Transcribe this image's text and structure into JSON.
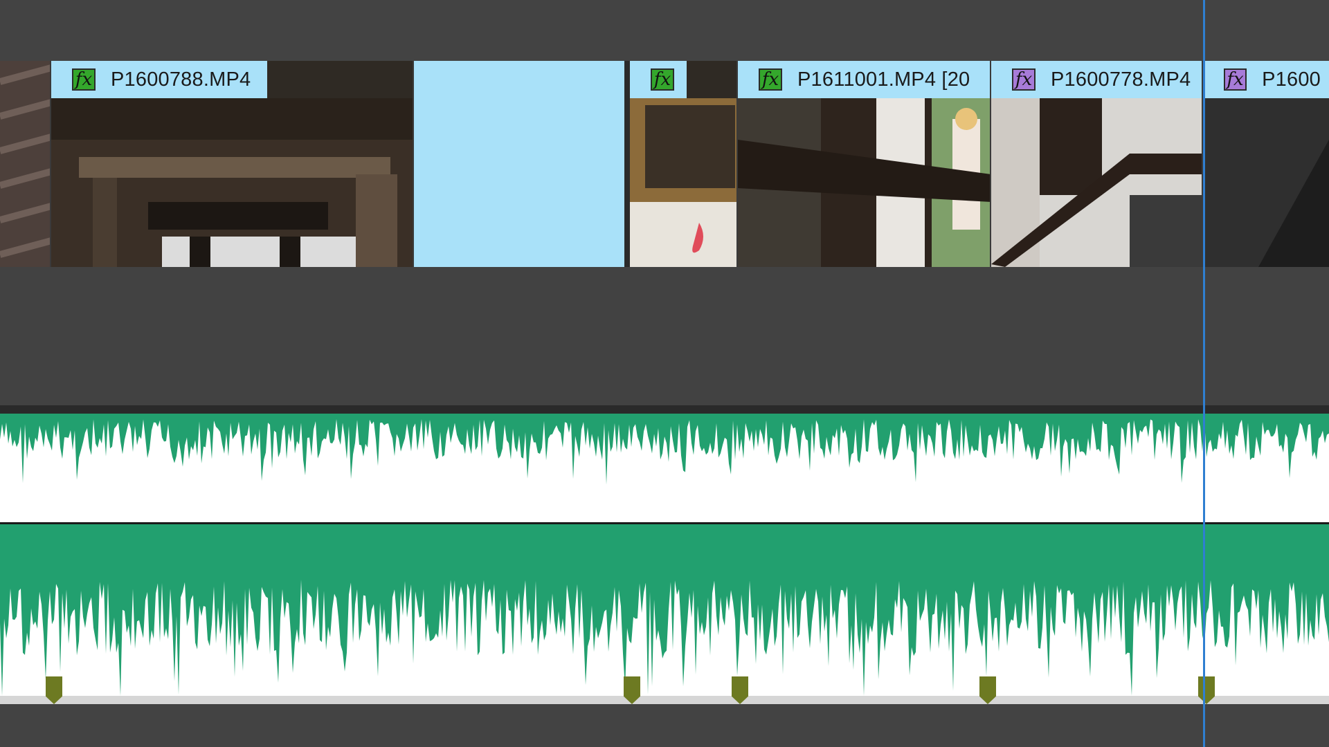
{
  "timeline": {
    "clips": [
      {
        "name": "P1600788.MP4",
        "fx": "green"
      },
      {
        "name": "",
        "fx": "green"
      },
      {
        "name": "P1611001.MP4 [20",
        "fx": "green"
      },
      {
        "name": "P1600778.MP4",
        "fx": "purple"
      },
      {
        "name": "P1600",
        "fx": "purple"
      }
    ],
    "fx_label": "fx",
    "colors": {
      "clip_header": "#a9e1f9",
      "fx_green": "#34a72c",
      "fx_purple": "#a77bd8",
      "waveform": "#22a06f",
      "marker": "#6d7a22",
      "playhead": "#2f7fd1"
    }
  }
}
